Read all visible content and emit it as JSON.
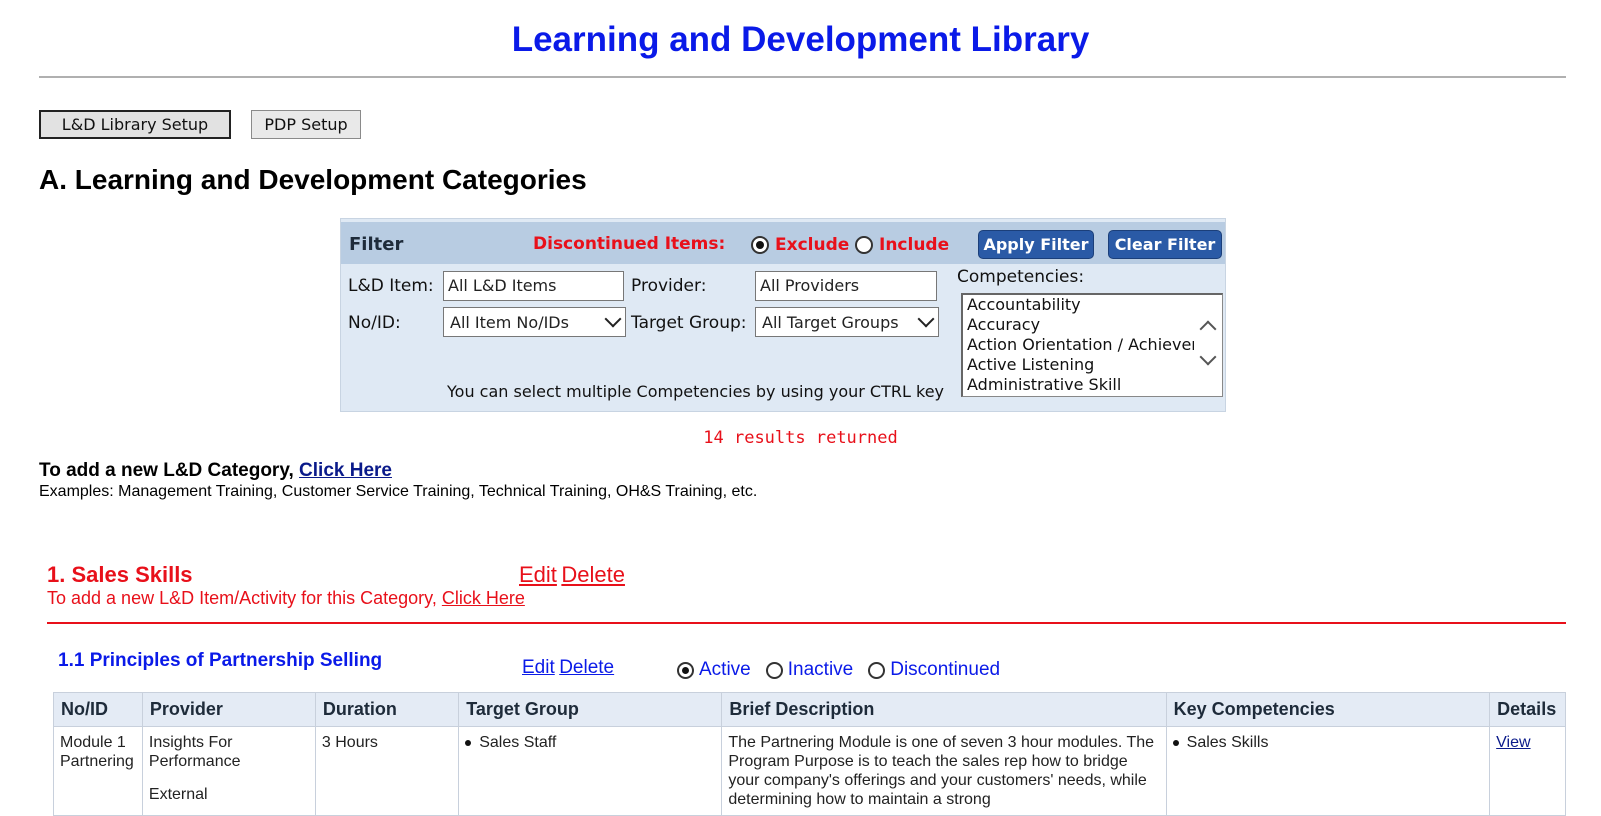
{
  "page": {
    "title": "Learning and Development Library",
    "buttons": {
      "library_setup": "L&D Library Setup",
      "pdp_setup": "PDP Setup"
    },
    "section_title": "A. Learning and Development Categories"
  },
  "filter": {
    "label": "Filter",
    "discontinued_label": "Discontinued Items:",
    "exclude_label": "Exclude",
    "include_label": "Include",
    "discontinued_selected": "Exclude",
    "apply_label": "Apply Filter",
    "clear_label": "Clear Filter",
    "ld_item_label": "L&D Item:",
    "ld_item_value": "All L&D Items",
    "provider_label": "Provider:",
    "provider_value": "All Providers",
    "noid_label": "No/ID:",
    "noid_value": "All Item No/IDs",
    "target_group_label": "Target Group:",
    "target_group_value": "All Target Groups",
    "competencies_label": "Competencies:",
    "competencies": [
      "Accountability",
      "Accuracy",
      "Action Orientation / Achievemer",
      "Active Listening",
      "Administrative Skill"
    ],
    "hint": "You can select multiple Competencies by using your CTRL key",
    "results_text": "14 results returned"
  },
  "add_category": {
    "prefix": "To add a new L&D Category,",
    "link": "Click Here",
    "examples": "Examples: Management Training, Customer Service Training, Technical Training, OH&S Training, etc."
  },
  "category": {
    "title": "1. Sales Skills",
    "edit": "Edit",
    "delete": "Delete",
    "add_item_prefix": "To add a new L&D Item/Activity for this Category,",
    "add_item_link": "Click Here"
  },
  "item": {
    "title": "1.1 Principles of Partnership Selling",
    "edit": "Edit",
    "delete": "Delete",
    "status_active": "Active",
    "status_inactive": "Inactive",
    "status_discontinued": "Discontinued",
    "status_selected": "Active"
  },
  "table": {
    "headers": [
      "No/ID",
      "Provider",
      "Duration",
      "Target Group",
      "Brief Description",
      "Key Competencies",
      "Details"
    ],
    "rows": [
      {
        "noid": "Module 1 Partnering",
        "provider": "Insights For Performance",
        "provider_type": "External",
        "duration": "3 Hours",
        "target_group": "Sales Staff",
        "description": "The Partnering Module is one of seven 3 hour modules. The Program Purpose is to teach the sales rep how to bridge your company's offerings and your customers' needs, while determining how to maintain a strong",
        "competency": "Sales Skills",
        "details_link": "View"
      }
    ]
  },
  "colors": {
    "title_blue": "#0a1ae8",
    "alert_red": "#e8101a",
    "button_blue": "#2a5aa6",
    "filter_header": "#b8cce2"
  }
}
